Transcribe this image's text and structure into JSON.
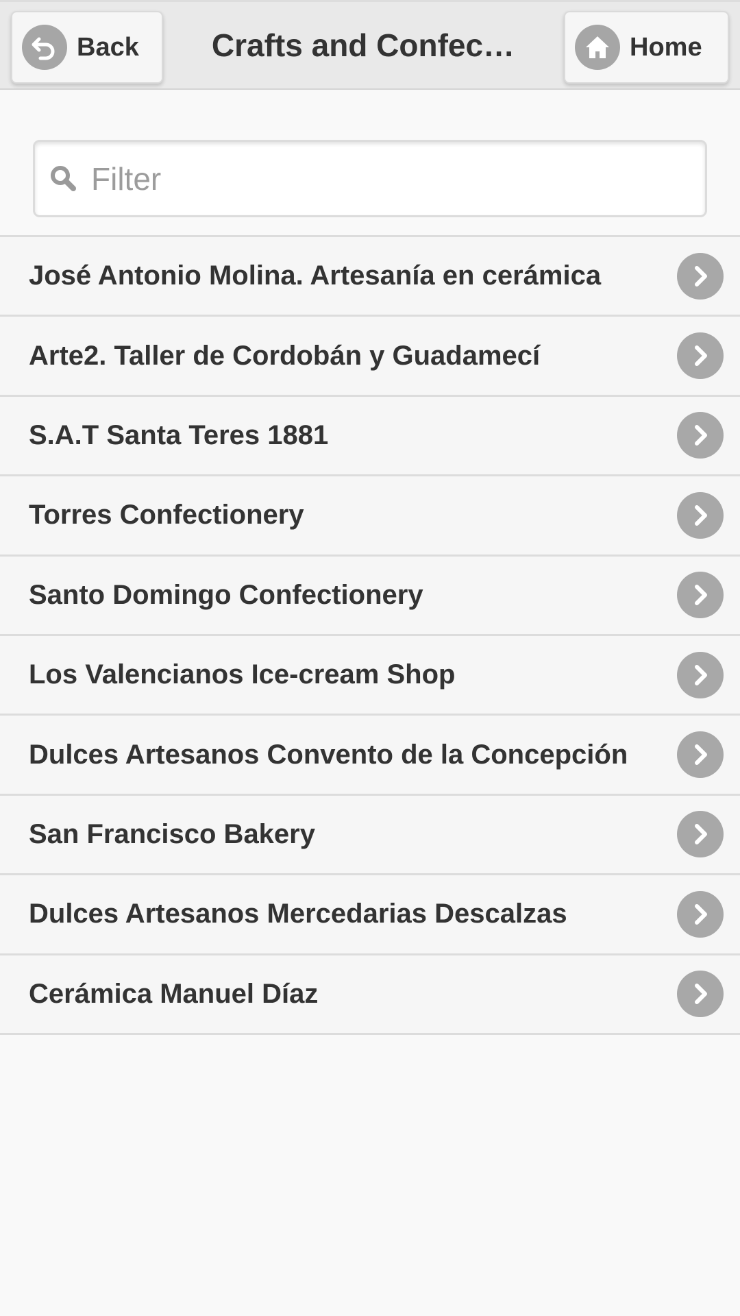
{
  "header": {
    "back_label": "Back",
    "title": "Crafts and Confec…",
    "home_label": "Home"
  },
  "filter": {
    "placeholder": "Filter",
    "value": ""
  },
  "list": {
    "items": [
      {
        "label": "José Antonio Molina. Artesanía en cerámica"
      },
      {
        "label": "Arte2. Taller de Cordobán y Guadamecí"
      },
      {
        "label": "S.A.T Santa Teres 1881"
      },
      {
        "label": "Torres Confectionery"
      },
      {
        "label": "Santo Domingo Confectionery"
      },
      {
        "label": "Los Valencianos Ice-cream Shop"
      },
      {
        "label": "Dulces Artesanos Convento de la Concepción"
      },
      {
        "label": "San Francisco Bakery"
      },
      {
        "label": "Dulces Artesanos Mercedarias Descalzas"
      },
      {
        "label": "Cerámica Manuel Díaz"
      }
    ]
  },
  "icons": {
    "back": "back-arrow-icon",
    "home": "home-icon",
    "search": "search-icon",
    "row_arrow": "chevron-right-icon"
  },
  "colors": {
    "header_bg": "#e9e9e9",
    "icon_gray": "#a6a6a6",
    "row_bg": "#f6f6f6",
    "text": "#333333"
  }
}
